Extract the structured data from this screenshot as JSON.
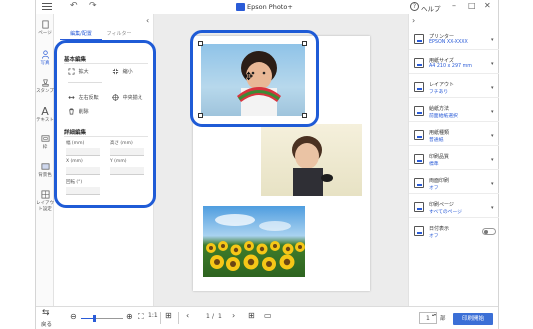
{
  "titlebar": {
    "title": "Epson Photo+",
    "help": "ヘルプ",
    "minimize": "–",
    "maximize": "□",
    "close": "✕",
    "undo": "↶",
    "redo": "↷"
  },
  "rail": {
    "items": [
      {
        "label": "ページ",
        "icon": "page-icon"
      },
      {
        "label": "写真",
        "icon": "photo-icon"
      },
      {
        "label": "スタンプ",
        "icon": "stamp-icon"
      },
      {
        "label": "テキスト",
        "icon": "text-icon"
      },
      {
        "label": "枠",
        "icon": "frame-icon"
      },
      {
        "label": "背景色",
        "icon": "background-icon"
      },
      {
        "label": "レイアウト設定",
        "icon": "layout-settings-icon"
      }
    ],
    "text_glyph": "A"
  },
  "edit_panel": {
    "tab_active": "編集/配置",
    "tab_other": "フィルター",
    "basic_title": "基本編集",
    "tools": {
      "zoom_in": "拡大",
      "zoom_out": "縮小",
      "flip_horizontal": "左右反転",
      "center": "中央揃え",
      "delete": "削除"
    },
    "detail_title": "詳細編集",
    "fields": {
      "width": "幅 (mm)",
      "height": "高さ (mm)",
      "x": "X (mm)",
      "y": "Y (mm)",
      "rotation": "回転 (°)"
    }
  },
  "right_panel": {
    "settings": [
      {
        "label": "プリンター",
        "value": "EPSON XX-XXXX"
      },
      {
        "label": "用紙サイズ",
        "value": "A4 210 x 297 mm"
      },
      {
        "label": "レイアウト",
        "value": "フチあり"
      },
      {
        "label": "給紙方法",
        "value": "前面給紙選択"
      },
      {
        "label": "用紙種類",
        "value": "普通紙"
      },
      {
        "label": "印刷品質",
        "value": "標準"
      },
      {
        "label": "両面印刷",
        "value": "オフ"
      },
      {
        "label": "印刷ページ",
        "value": "すべてのページ"
      },
      {
        "label": "日付表示",
        "value": "オフ"
      }
    ]
  },
  "bottombar": {
    "back": "戻る",
    "page_current": "1",
    "page_sep": "/",
    "page_total": "1",
    "copies": "1",
    "copies_unit": "部",
    "print": "印刷開始"
  }
}
